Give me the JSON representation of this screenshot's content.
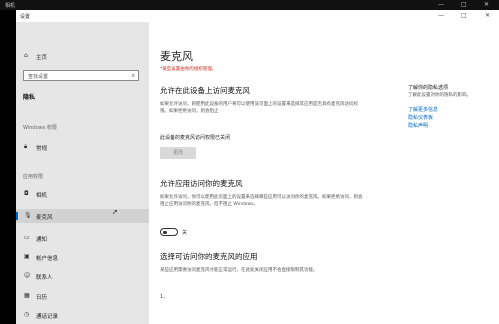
{
  "outer_window": {
    "title": "相机",
    "controls": [
      "—",
      "□",
      "✕"
    ]
  },
  "window": {
    "title": "设置",
    "controls": [
      "—",
      "□",
      "✕"
    ]
  },
  "sidebar": {
    "home_label": "主页",
    "search_placeholder": "查找设置",
    "section_privacy": "隐私",
    "section_windows_perms": "Windows 权限",
    "general_label": "常规",
    "section_app_perms": "应用权限",
    "items": [
      {
        "label": "相机",
        "icon": "camera-icon"
      },
      {
        "label": "麦克风",
        "icon": "microphone-icon",
        "selected": true
      },
      {
        "label": "通知",
        "icon": "notification-icon"
      },
      {
        "label": "帐户信息",
        "icon": "account-info-icon"
      },
      {
        "label": "联系人",
        "icon": "contacts-icon"
      },
      {
        "label": "日历",
        "icon": "calendar-icon"
      },
      {
        "label": "通话记录",
        "icon": "call-history-icon"
      }
    ]
  },
  "main": {
    "title": "麦克风",
    "warning": "*某些设置由你的组织管理。",
    "device_section": {
      "heading": "允许在此设备上访问麦克风",
      "description": "如果允许访问，则使用此设备的用户将可以使用该页面上的设置来选择其应用是否具有麦克风访问权限。如果拒绝访问，则会阻止",
      "status": "此设备的麦克风访问权限已关闭",
      "change_button": "更改"
    },
    "app_section": {
      "heading": "允许应用访问你的麦克风",
      "description": "如果允许访问，你可以使用此页面上的设置来选择哪些应用可以访问你的麦克风。如果拒绝访问，则会阻止应用访问你的麦克风。但不阻止 Windows。",
      "toggle_label": "关",
      "toggle_on": false
    },
    "choose_section": {
      "heading": "选择可访问你的麦克风的应用",
      "description": "某些应用需要访问麦克风才能正常运行。在此处关闭应用不会直接限制其功能。",
      "footnote": "1、"
    }
  },
  "right_panel": {
    "heading": "了解你的隐私选项",
    "description": "了解此设置对你的隐私的影响。",
    "links": [
      "了解更多信息",
      "隐私仪表板",
      "隐私声明"
    ]
  },
  "colors": {
    "accent": "#0067c0",
    "warning": "#c42b1c",
    "sidebar_bg": "#e6e6e6"
  }
}
